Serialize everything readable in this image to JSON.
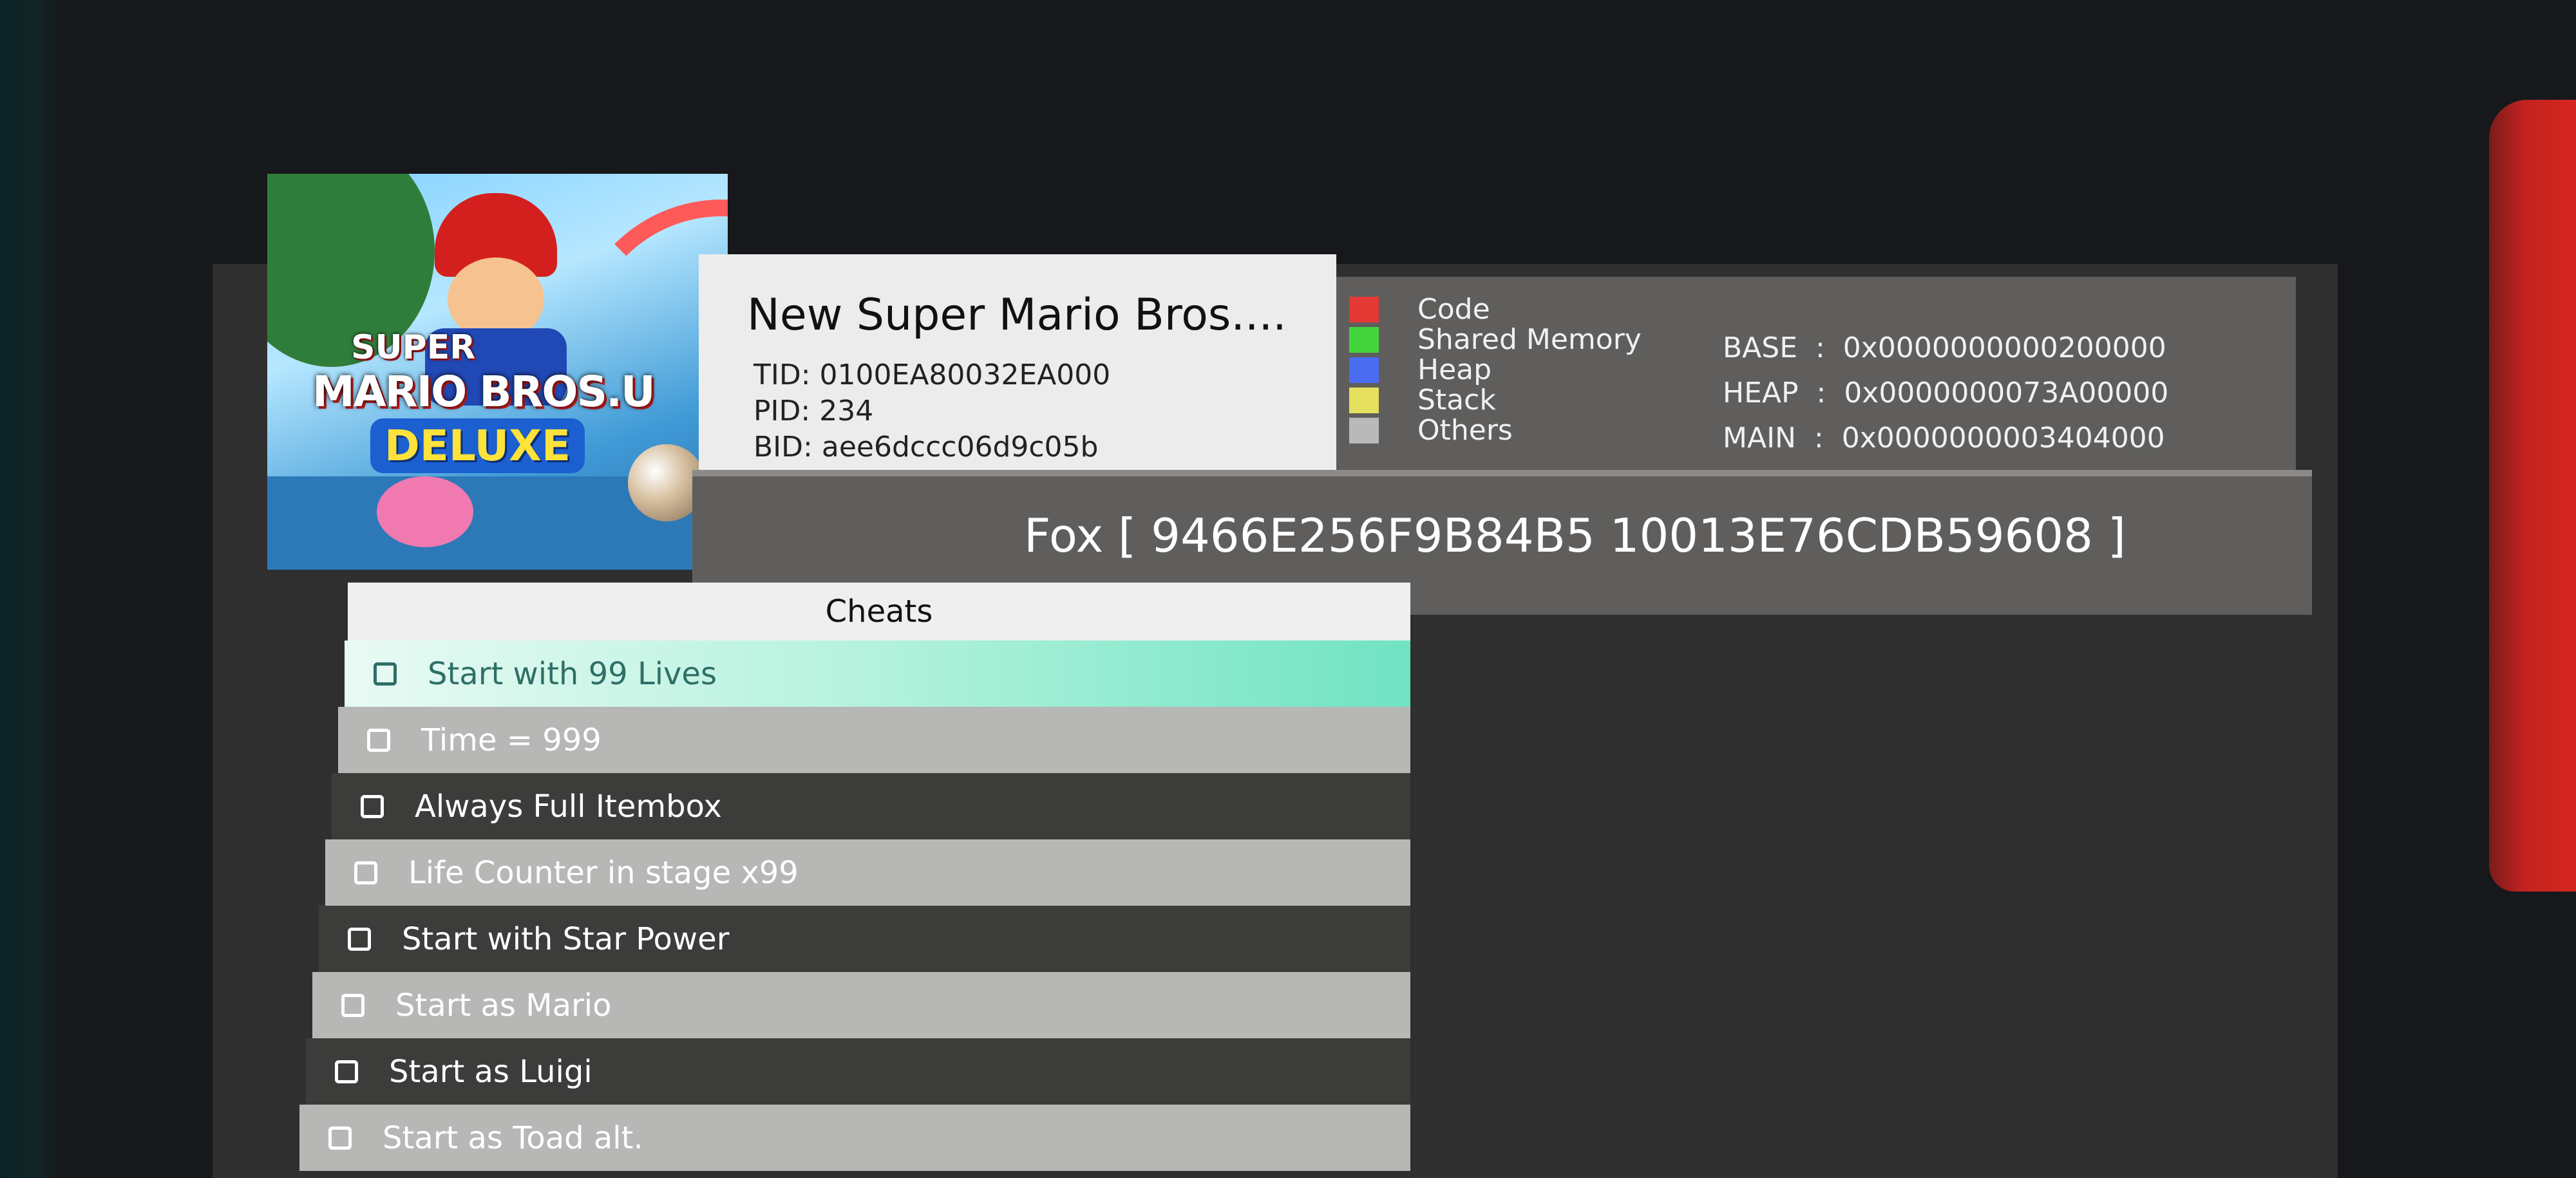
{
  "game": {
    "art_text": {
      "line1": "SUPER",
      "line2": "MARIO BROS.U",
      "line3": "DELUXE"
    },
    "name": "New Super Mario Bros....",
    "tid": "TID: 0100EA80032EA000",
    "pid": "PID: 234",
    "bid": "BID: aee6dccc06d9c05b"
  },
  "memory_legend": [
    {
      "label": "Code",
      "color": "#e53935"
    },
    {
      "label": "Shared Memory",
      "color": "#43d43b"
    },
    {
      "label": "Heap",
      "color": "#4a6cf0"
    },
    {
      "label": "Stack",
      "color": "#e5e060"
    },
    {
      "label": "Others",
      "color": "#b9b9b9"
    }
  ],
  "addresses": [
    {
      "label": "BASE",
      "value": "0x0000000000200000"
    },
    {
      "label": "HEAP",
      "value": "0x0000000073A00000"
    },
    {
      "label": "MAIN",
      "value": "0x0000000003404000"
    }
  ],
  "build_id_line": "Fox [ 9466E256F9B84B5 10013E76CDB59608 ]",
  "cheats": {
    "header": "Cheats",
    "items": [
      {
        "label": "Start with 99 Lives",
        "checked": false,
        "selected": true
      },
      {
        "label": "Time = 999",
        "checked": false
      },
      {
        "label": "Always Full Itembox",
        "checked": false
      },
      {
        "label": "Life Counter in stage x99",
        "checked": false
      },
      {
        "label": "Start with Star Power",
        "checked": false
      },
      {
        "label": "Start as Mario",
        "checked": false
      },
      {
        "label": "Start as Luigi",
        "checked": false
      },
      {
        "label": "Start as Toad alt.",
        "checked": false
      }
    ]
  }
}
